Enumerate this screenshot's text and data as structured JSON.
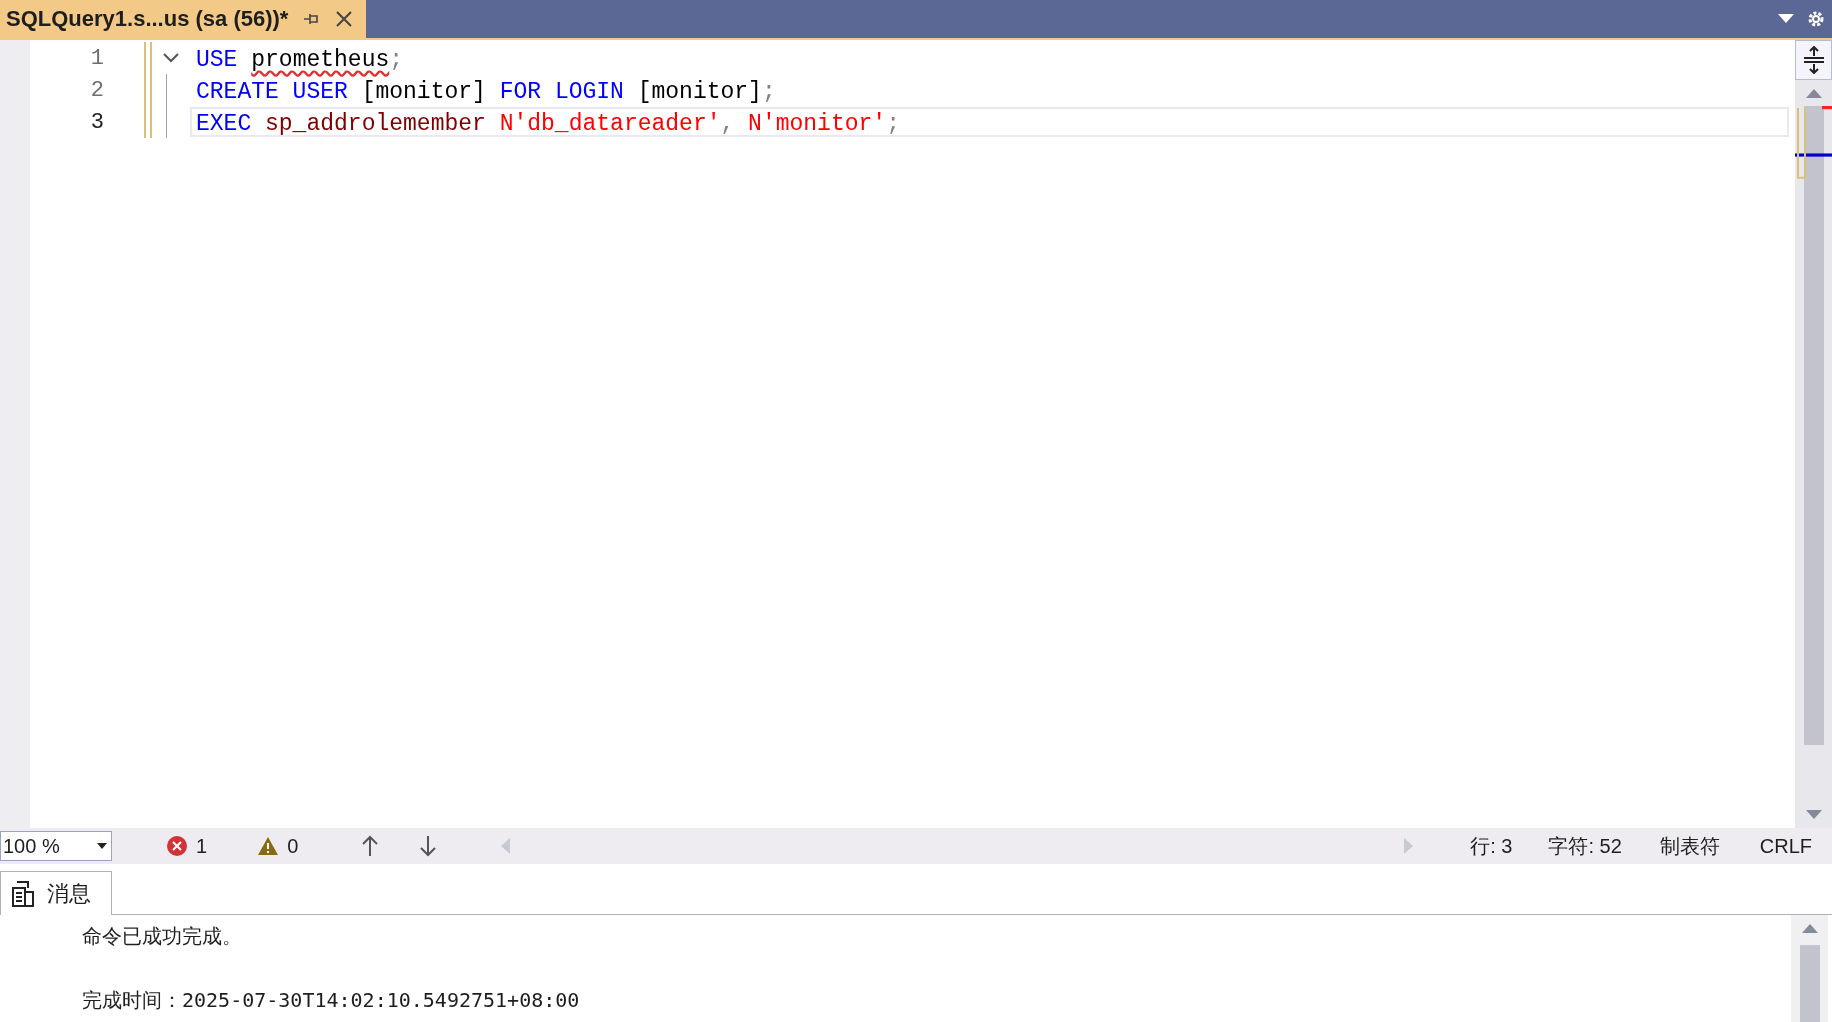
{
  "tab": {
    "title": "SQLQuery1.s...us (sa (56))*",
    "selected": true
  },
  "editor": {
    "lines": [
      {
        "number": "1",
        "current": false,
        "changed": true,
        "foldable": true,
        "tokens": [
          {
            "kind": "keyword",
            "text": "USE "
          },
          {
            "kind": "plain",
            "text": "prometheus",
            "error": true
          },
          {
            "kind": "punct",
            "text": ";"
          }
        ]
      },
      {
        "number": "2",
        "current": false,
        "changed": true,
        "foldable": false,
        "tokens": [
          {
            "kind": "keyword",
            "text": "CREATE USER "
          },
          {
            "kind": "plain",
            "text": "[monitor] "
          },
          {
            "kind": "keyword",
            "text": "FOR LOGIN "
          },
          {
            "kind": "plain",
            "text": "[monitor]"
          },
          {
            "kind": "punct",
            "text": ";"
          }
        ]
      },
      {
        "number": "3",
        "current": true,
        "changed": true,
        "foldable": false,
        "tokens": [
          {
            "kind": "keyword",
            "text": "EXEC "
          },
          {
            "kind": "proc",
            "text": "sp_addrolemember "
          },
          {
            "kind": "string",
            "text": "N'db_datareader'"
          },
          {
            "kind": "punct",
            "text": ", "
          },
          {
            "kind": "string",
            "text": "N'monitor'"
          },
          {
            "kind": "punct",
            "text": ";"
          }
        ]
      }
    ]
  },
  "status_bar": {
    "zoom": "100 %",
    "errors": "1",
    "warnings": "0",
    "line": "行: 3",
    "char": "字符: 52",
    "indent": "制表符",
    "line_ending": "CRLF"
  },
  "results": {
    "tabs": [
      {
        "label": "消息",
        "selected": true
      }
    ],
    "messages": [
      "命令已成功完成。",
      "完成时间：2025-07-30T14:02:10.5492751+08:00"
    ]
  }
}
